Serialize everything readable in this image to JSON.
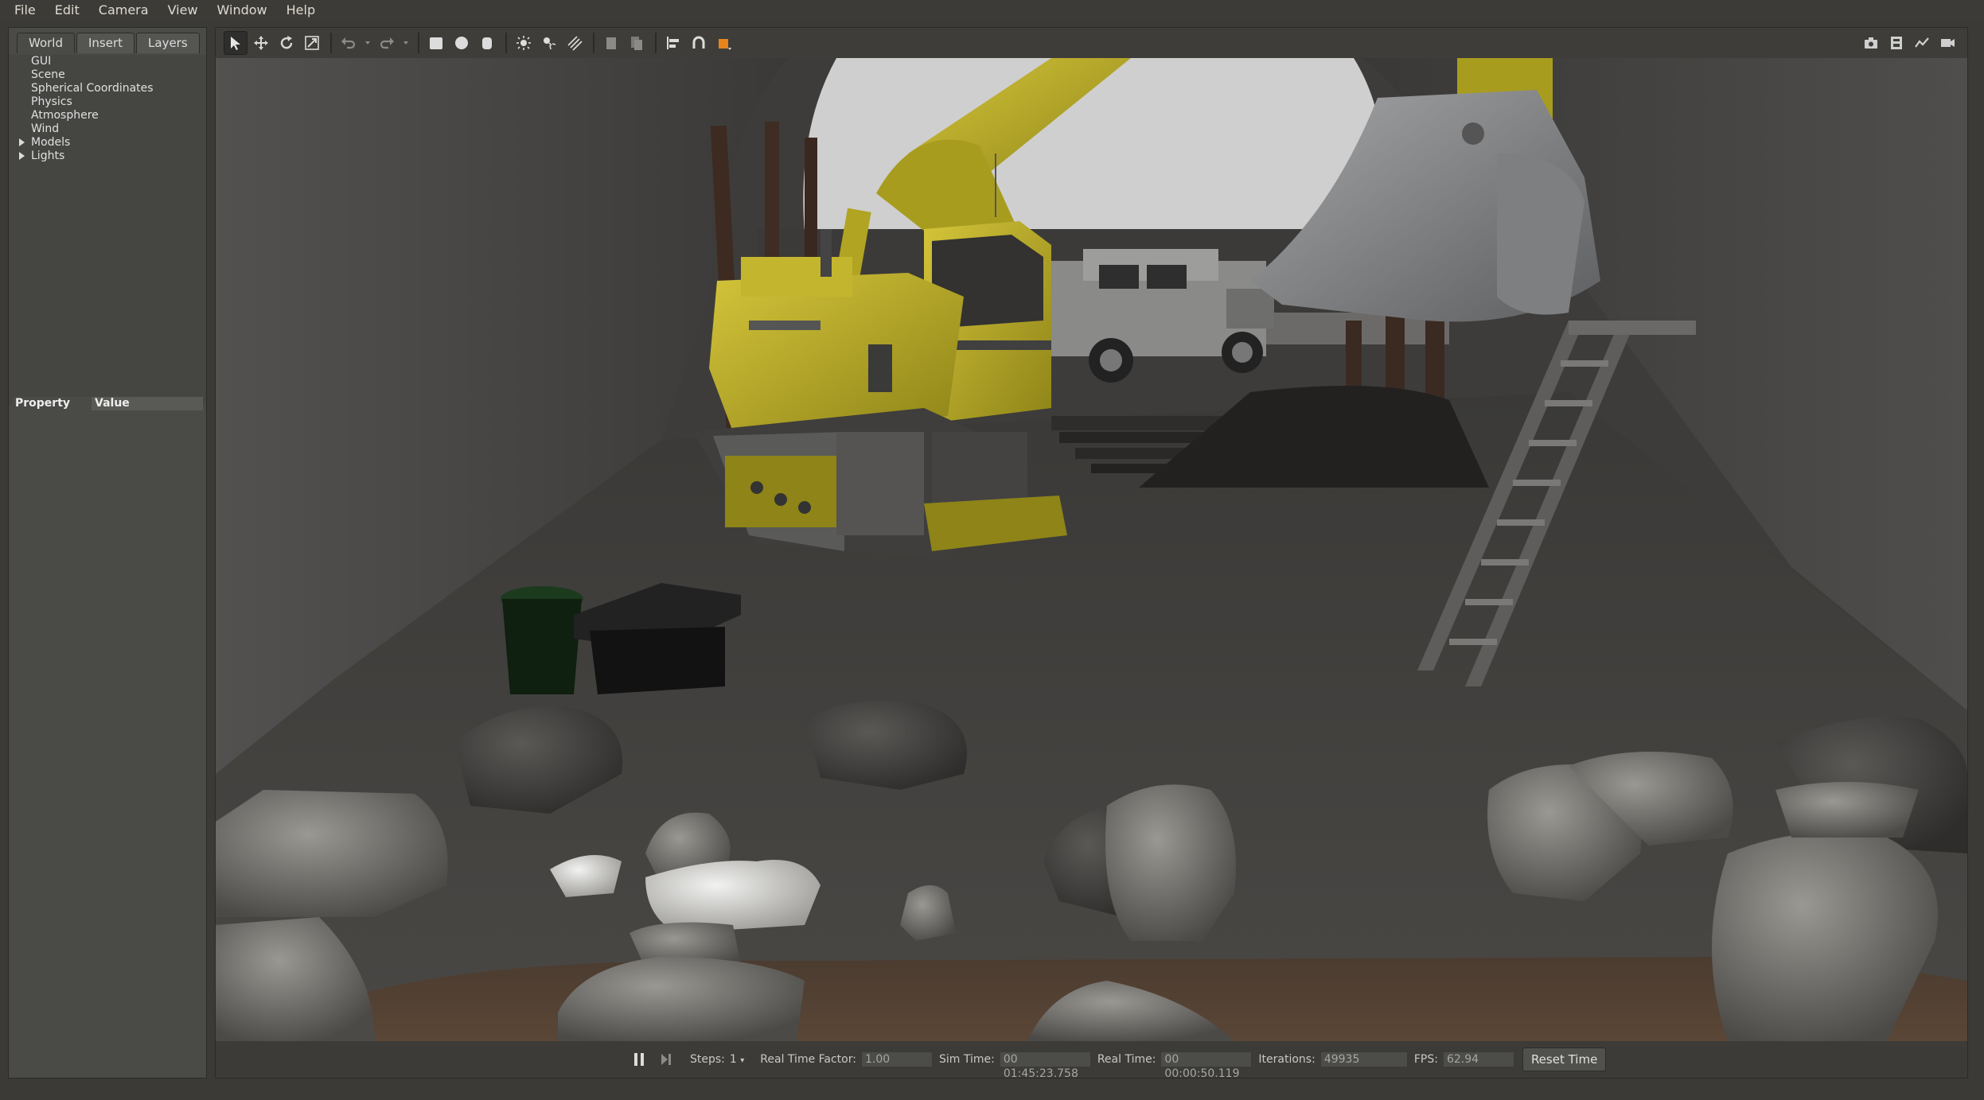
{
  "menubar": {
    "items": [
      {
        "label": "File"
      },
      {
        "label": "Edit"
      },
      {
        "label": "Camera"
      },
      {
        "label": "View"
      },
      {
        "label": "Window"
      },
      {
        "label": "Help"
      }
    ]
  },
  "left_panel": {
    "tabs": [
      {
        "label": "World",
        "active": true
      },
      {
        "label": "Insert",
        "active": false
      },
      {
        "label": "Layers",
        "active": false
      }
    ],
    "tree": [
      {
        "label": "GUI",
        "expandable": false
      },
      {
        "label": "Scene",
        "expandable": false
      },
      {
        "label": "Spherical Coordinates",
        "expandable": false
      },
      {
        "label": "Physics",
        "expandable": false
      },
      {
        "label": "Atmosphere",
        "expandable": false
      },
      {
        "label": "Wind",
        "expandable": false
      },
      {
        "label": "Models",
        "expandable": true
      },
      {
        "label": "Lights",
        "expandable": true
      }
    ],
    "property_header": {
      "property": "Property",
      "value": "Value"
    }
  },
  "toolbar": {
    "left_icons": [
      "select-arrow-icon",
      "translate-icon",
      "rotate-icon",
      "scale-icon",
      "undo-icon",
      "redo-icon",
      "box-icon",
      "sphere-icon",
      "cylinder-icon",
      "point-light-icon",
      "spot-light-icon",
      "directional-light-icon",
      "copy-icon",
      "paste-icon",
      "align-icon",
      "snap-icon",
      "view-angle-icon"
    ],
    "right_icons": [
      "screenshot-icon",
      "log-icon",
      "plot-icon",
      "record-icon"
    ]
  },
  "status": {
    "steps_label": "Steps:",
    "steps_value": "1",
    "rtf_label": "Real Time Factor:",
    "rtf_value": "1.00",
    "sim_time_label": "Sim Time:",
    "sim_time_value": "00 01:45:23.758",
    "real_time_label": "Real Time:",
    "real_time_value": "00 00:00:50.119",
    "iterations_label": "Iterations:",
    "iterations_value": "49935",
    "fps_label": "FPS:",
    "fps_value": "62.94",
    "reset_label": "Reset Time"
  },
  "colors": {
    "excavator_yellow": "#bfb21e",
    "ground": "#3e3d3b",
    "wall": "#4a4946",
    "sky": "#cfcfcf"
  }
}
